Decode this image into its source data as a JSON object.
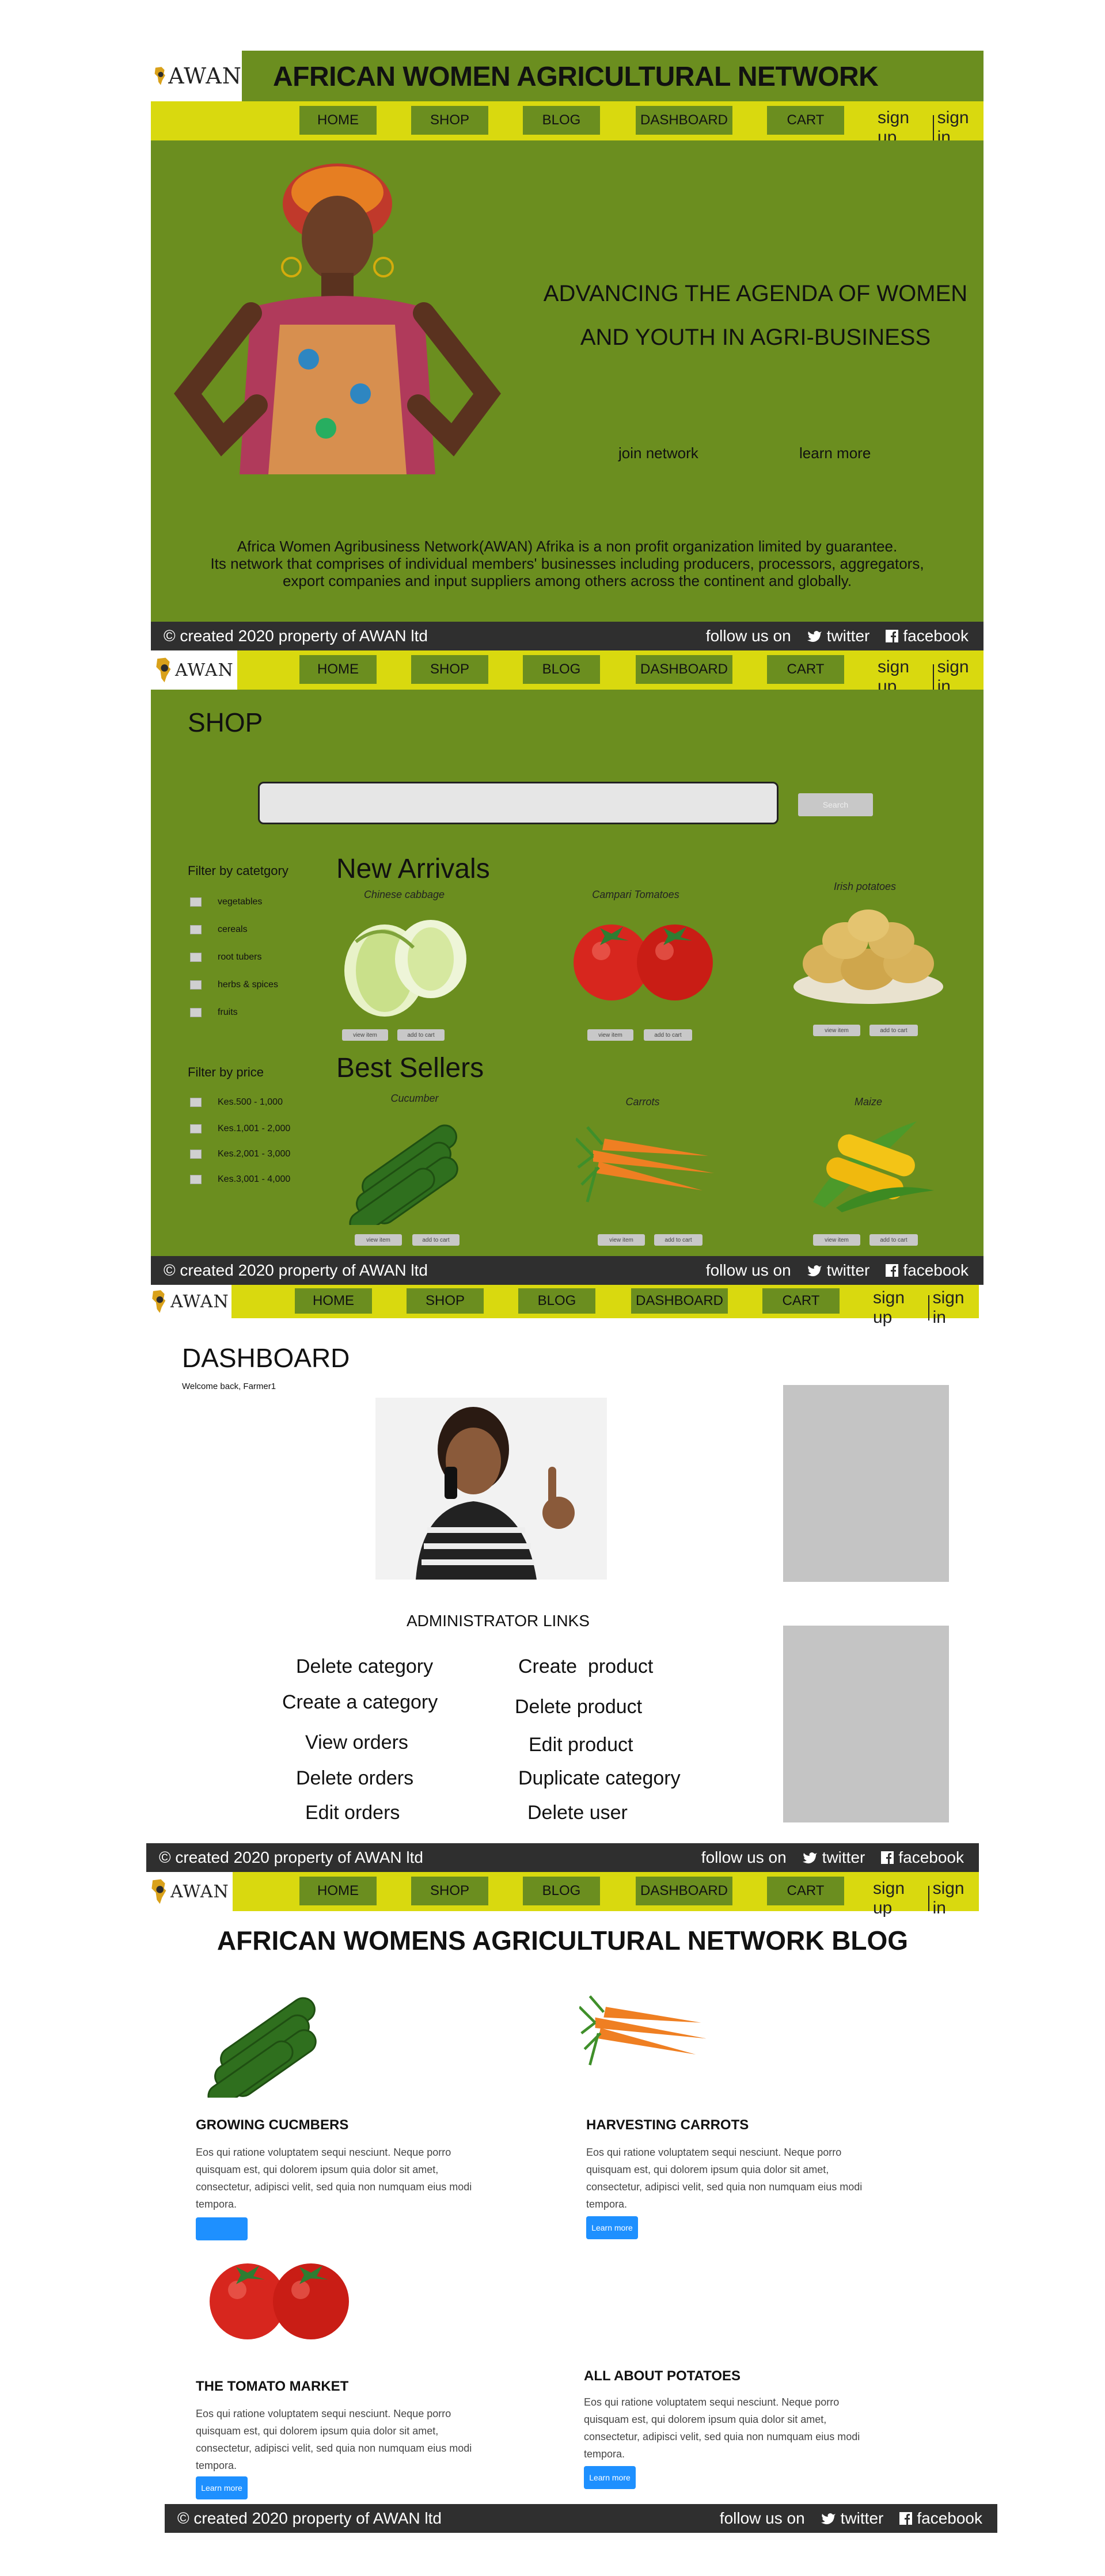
{
  "brand": {
    "logo_text": "AWAN",
    "title": "AFRICAN WOMEN AGRICULTURAL NETWORK"
  },
  "nav": {
    "items": [
      "HOME",
      "SHOP",
      "BLOG",
      "DASHBOARD",
      "CART"
    ],
    "sign_up": "sign up",
    "sign_in": "sign in"
  },
  "hero": {
    "headline_line1": "ADVANCING THE AGENDA OF WOMEN",
    "headline_line2": "AND YOUTH IN AGRI-BUSINESS",
    "join": "join network",
    "learn": "learn more",
    "about_line1": "Africa Women Agribusiness Network(AWAN) Afrika is a non profit organization limited by guarantee.",
    "about_line2": "Its network that comprises of individual members' businesses including producers, processors, aggregators,",
    "about_line3": "export companies and input suppliers among others across the continent and globally."
  },
  "footer": {
    "copyright": "© created 2020 property of AWAN ltd",
    "follow": "follow us on",
    "twitter": "twitter",
    "facebook": "facebook"
  },
  "shop": {
    "title": "SHOP",
    "search_button": "Search",
    "filter_category_label": "Filter by catetgory",
    "categories": [
      "vegetables",
      "cereals",
      "root tubers",
      "herbs & spices",
      "fruits"
    ],
    "filter_price_label": "Filter by price",
    "prices": [
      "Kes.500 - 1,000",
      "Kes.1,001 - 2,000",
      "Kes.2,001 - 3,000",
      "Kes.3,001 - 4,000"
    ],
    "new_arrivals": "New Arrivals",
    "best_sellers": "Best Sellers",
    "products_new": [
      "Chinese cabbage",
      "Campari Tomatoes",
      "Irish potatoes"
    ],
    "products_best": [
      "Cucumber",
      "Carrots",
      "Maize"
    ],
    "view_item": "view item",
    "add_to_cart": "add to cart"
  },
  "dashboard": {
    "title": "DASHBOARD",
    "welcome": "Welcome back, Farmer1",
    "admin_heading": "ADMINISTRATOR LINKS",
    "links_left": [
      "Delete category",
      "Create a category",
      "View orders",
      "Delete orders",
      "Edit orders"
    ],
    "links_right": [
      "Create  product",
      "Delete product",
      "Edit product",
      "Duplicate category",
      "Delete user"
    ]
  },
  "blog": {
    "title": "AFRICAN WOMENS AGRICULTURAL NETWORK BLOG",
    "lorem": "Eos qui ratione voluptatem sequi nesciunt. Neque porro quisquam est, qui dolorem ipsum quia dolor sit amet, consectetur, adipisci velit, sed quia non numquam eius modi tempora.",
    "learn_more": "Learn more",
    "posts": [
      "GROWING CUCMBERS",
      "HARVESTING CARROTS",
      "THE TOMATO MARKET",
      "ALL ABOUT POTATOES"
    ]
  },
  "colors": {
    "green": "#6b8e1f",
    "yellow": "#d9d90f",
    "footer": "#2f2f2f",
    "blog_button": "#1e90ff"
  }
}
